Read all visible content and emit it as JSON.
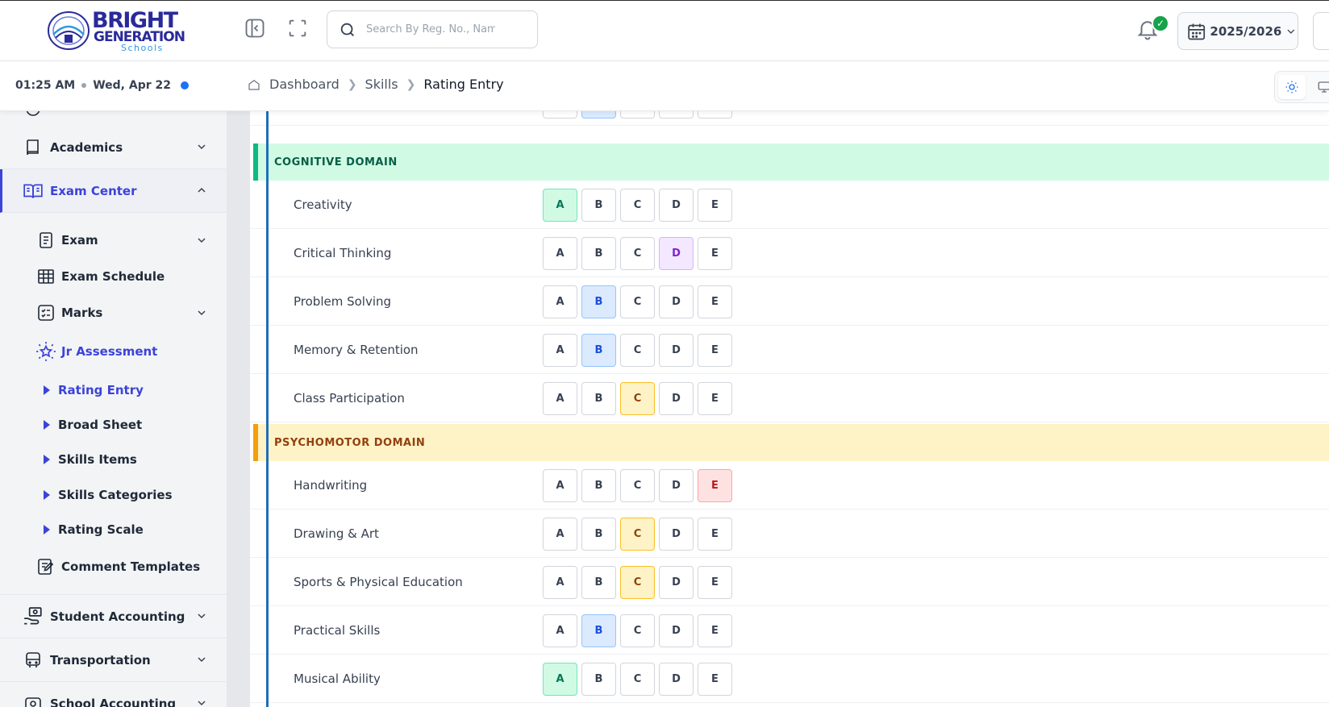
{
  "header": {
    "logo": {
      "line1": "BRIGHT",
      "line2": "GENERATION",
      "line3": "Schools"
    },
    "search_placeholder": "Search By Reg. No., Name",
    "notification_badge": "✓",
    "session": "2025/2026"
  },
  "subheader": {
    "time": "01:25 AM",
    "date": "Wed, Apr 22",
    "breadcrumb": [
      "Dashboard",
      "Skills",
      "Rating Entry"
    ]
  },
  "sidebar": {
    "groups": {
      "academics": "Academics",
      "exam_center": "Exam Center",
      "student_accounting": "Student Accounting",
      "transportation": "Transportation",
      "school_accounting": "School Accounting"
    },
    "exam_items": {
      "exam": "Exam",
      "exam_schedule": "Exam Schedule",
      "marks": "Marks",
      "jr_assessment": "Jr Assessment",
      "comment_templates": "Comment Templates"
    },
    "jr_sub": {
      "rating_entry": "Rating Entry",
      "broad_sheet": "Broad Sheet",
      "skills_items": "Skills Items",
      "skills_categories": "Skills Categories",
      "rating_scale": "Rating Scale"
    }
  },
  "grade_scale": [
    "A",
    "B",
    "C",
    "D",
    "E"
  ],
  "domains": {
    "cognitive": {
      "title": "COGNITIVE DOMAIN",
      "skills": [
        {
          "name": "Creativity",
          "rating": "A"
        },
        {
          "name": "Critical Thinking",
          "rating": "D"
        },
        {
          "name": "Problem Solving",
          "rating": "B"
        },
        {
          "name": "Memory & Retention",
          "rating": "B"
        },
        {
          "name": "Class Participation",
          "rating": "C"
        }
      ]
    },
    "psychomotor": {
      "title": "PSYCHOMOTOR DOMAIN",
      "skills": [
        {
          "name": "Handwriting",
          "rating": "E"
        },
        {
          "name": "Drawing & Art",
          "rating": "C"
        },
        {
          "name": "Sports & Physical Education",
          "rating": "C"
        },
        {
          "name": "Practical Skills",
          "rating": "B"
        },
        {
          "name": "Musical Ability",
          "rating": "A"
        }
      ]
    },
    "previous_row_rating": "B"
  }
}
